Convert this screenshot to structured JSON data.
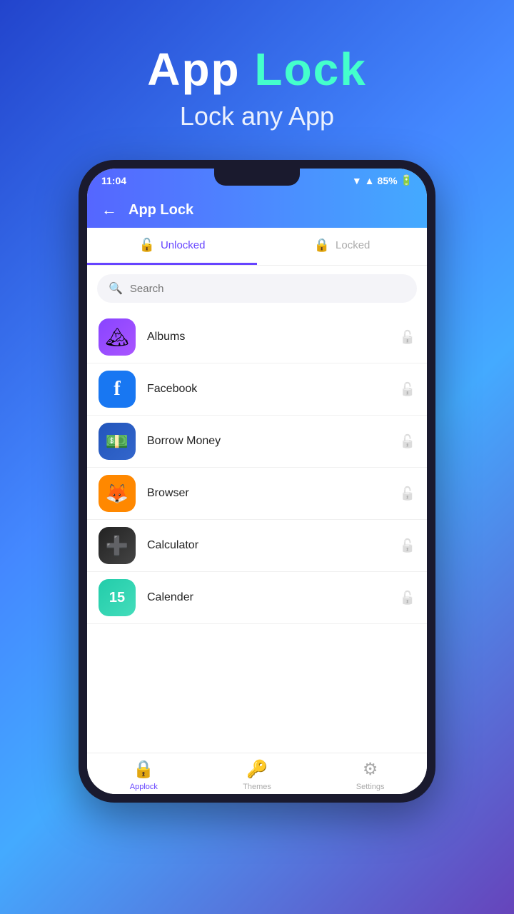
{
  "hero": {
    "title_part1": "App ",
    "title_part2": "Lock",
    "subtitle": "Lock any App"
  },
  "statusBar": {
    "time": "11:04",
    "battery": "85%"
  },
  "header": {
    "title": "App Lock"
  },
  "tabs": [
    {
      "id": "unlocked",
      "label": "Unlocked",
      "active": true
    },
    {
      "id": "locked",
      "label": "Locked",
      "active": false
    }
  ],
  "search": {
    "placeholder": "Search"
  },
  "apps": [
    {
      "name": "Albums",
      "icon": "🏔",
      "iconClass": "icon-albums"
    },
    {
      "name": "Facebook",
      "icon": "f",
      "iconClass": "icon-facebook",
      "iconStyle": "font-weight:800;color:white;font-size:28px;font-family:serif;"
    },
    {
      "name": "Borrow Money",
      "icon": "💵",
      "iconClass": "icon-borrow"
    },
    {
      "name": "Browser",
      "icon": "🦊",
      "iconClass": "icon-browser"
    },
    {
      "name": "Calculator",
      "icon": "➕",
      "iconClass": "icon-calculator"
    },
    {
      "name": "Calender",
      "icon": "15",
      "iconClass": "icon-calender",
      "iconStyle": "font-weight:800;color:white;font-size:20px;"
    }
  ],
  "bottomNav": [
    {
      "id": "applock",
      "label": "Applock",
      "icon": "🔒",
      "active": true
    },
    {
      "id": "themes",
      "label": "Themes",
      "icon": "🔑",
      "active": false
    },
    {
      "id": "settings",
      "label": "Settings",
      "icon": "⚙",
      "active": false
    }
  ]
}
